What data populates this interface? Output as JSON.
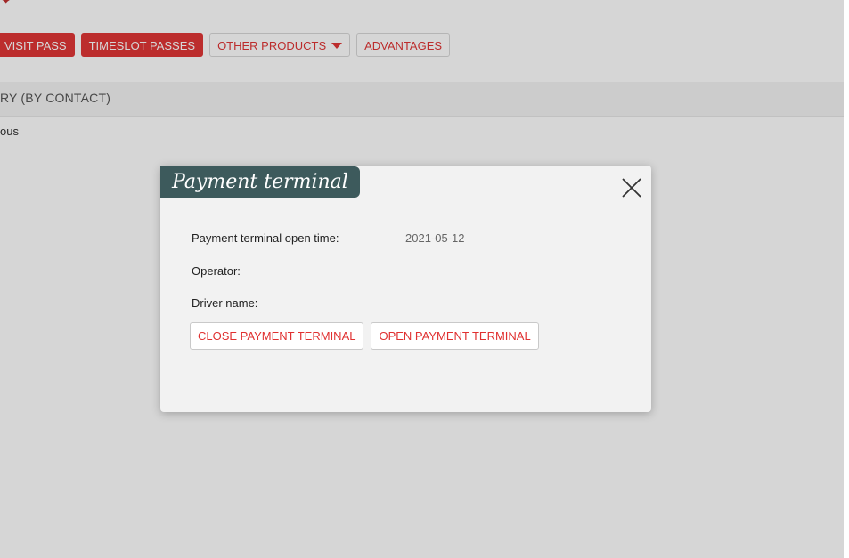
{
  "nav": {
    "items": [
      {
        "label": "VISIT PASS",
        "style": "filled"
      },
      {
        "label": "TIMESLOT PASSES",
        "style": "filled"
      },
      {
        "label": "OTHER PRODUCTS",
        "style": "outline",
        "has_caret": true
      },
      {
        "label": "ADVANTAGES",
        "style": "outline"
      }
    ]
  },
  "section": {
    "title": "RY (BY CONTACT)",
    "sub": "ous"
  },
  "modal": {
    "title": "Payment terminal",
    "close_icon": "close-icon",
    "fields": {
      "open_time_label": "Payment terminal open time:",
      "open_time_value": "2021-05-12",
      "operator_label": "Operator:",
      "operator_value": "",
      "driver_label": "Driver name:",
      "driver_value": ""
    },
    "buttons": {
      "close_terminal": "CLOSE PAYMENT TERMINAL",
      "open_terminal": "OPEN PAYMENT TERMINAL"
    }
  },
  "colors": {
    "accent_red": "#e03636",
    "modal_title_bg": "#3d5a5c",
    "modal_bg": "#f2f2f2"
  }
}
